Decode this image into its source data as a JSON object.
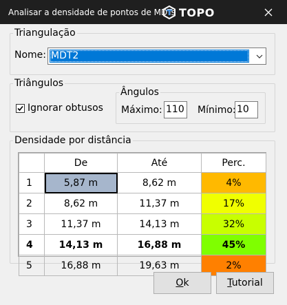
{
  "window": {
    "title": "Analisar a densidade de pontos de MDTs",
    "brand": "TOPO",
    "brand_color": "#4a90d9"
  },
  "triangulacao": {
    "legend": "Triangulação",
    "nome_label": "Nome:",
    "nome_value": "MDT2"
  },
  "triangulos": {
    "legend": "Triângulos",
    "ignorar_label": "Ignorar obtusos",
    "ignorar_checked": true,
    "angulos": {
      "legend": "Ângulos",
      "maximo_label": "Máximo:",
      "maximo_value": "110",
      "minimo_label": "Mínimo:",
      "minimo_value": "10"
    }
  },
  "densidade": {
    "legend": "Densidade por distância",
    "headers": [
      "",
      "De",
      "Até",
      "Perc."
    ],
    "rows": [
      {
        "n": "1",
        "de": "5,87 m",
        "ate": "8,62 m",
        "perc": "4%",
        "color": "#ffb900",
        "bold": false
      },
      {
        "n": "2",
        "de": "8,62 m",
        "ate": "11,37 m",
        "perc": "17%",
        "color": "#f0ff00",
        "bold": false
      },
      {
        "n": "3",
        "de": "11,37 m",
        "ate": "14,13 m",
        "perc": "32%",
        "color": "#c8ff00",
        "bold": false
      },
      {
        "n": "4",
        "de": "14,13 m",
        "ate": "16,88 m",
        "perc": "45%",
        "color": "#7fff00",
        "bold": true
      },
      {
        "n": "5",
        "de": "16,88 m",
        "ate": "19,63 m",
        "perc": "2%",
        "color": "#ff8000",
        "bold": false
      }
    ]
  },
  "buttons": {
    "ok_accel": "O",
    "ok_rest": "k",
    "tutorial_accel": "T",
    "tutorial_rest": "utorial"
  }
}
